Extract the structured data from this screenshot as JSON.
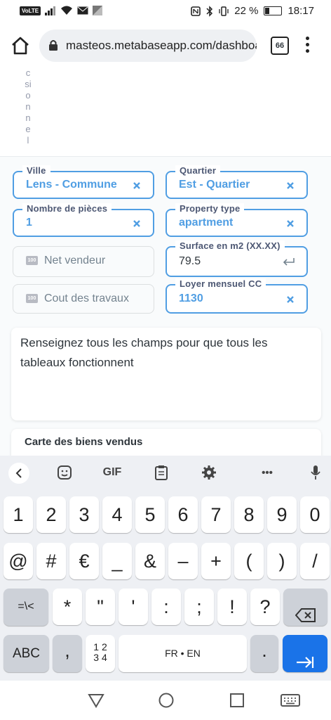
{
  "status_bar": {
    "network": "VoLTE",
    "battery": "22 %",
    "battery_level": 0.22,
    "time": "18:17"
  },
  "browser": {
    "url": "masteos.metabaseapp.com/dashboard",
    "tab_count": "66"
  },
  "dashboard": {
    "vertical_fragment": [
      "c",
      "si",
      "o",
      "n",
      "n",
      "e",
      "l"
    ],
    "filters": {
      "ville": {
        "label": "Ville",
        "value": "Lens - Commune"
      },
      "quartier": {
        "label": "Quartier",
        "value": "Est - Quartier"
      },
      "pieces": {
        "label": "Nombre de pièces",
        "value": "1"
      },
      "property_type": {
        "label": "Property type",
        "value": "apartment"
      },
      "net_vendeur": {
        "placeholder": "Net vendeur",
        "icon": "100"
      },
      "surface": {
        "label": "Surface en m2 (XX.XX)",
        "value": "79.5"
      },
      "travaux": {
        "placeholder": "Cout des travaux",
        "icon": "100"
      },
      "loyer": {
        "label": "Loyer mensuel CC",
        "value": "1130"
      }
    },
    "text_card": "Renseignez tous les champs pour que tous les tableaux fonctionnent",
    "map_card_title": "Carte des biens vendus"
  },
  "keyboard": {
    "toolbar": {
      "gif": "GIF",
      "more": "•••"
    },
    "row1": [
      "1",
      "2",
      "3",
      "4",
      "5",
      "6",
      "7",
      "8",
      "9",
      "0"
    ],
    "row2": [
      "@",
      "#",
      "€",
      "_",
      "&",
      "–",
      "+",
      "(",
      ")",
      "/"
    ],
    "row3": [
      "=\\<",
      "*",
      "\"",
      "'",
      ":",
      ";",
      "!",
      "?"
    ],
    "bottom": {
      "abc": "ABC",
      "comma": ",",
      "num_top": "1 2",
      "num_bottom": "3 4",
      "space": "FR • EN",
      "period": "."
    }
  }
}
